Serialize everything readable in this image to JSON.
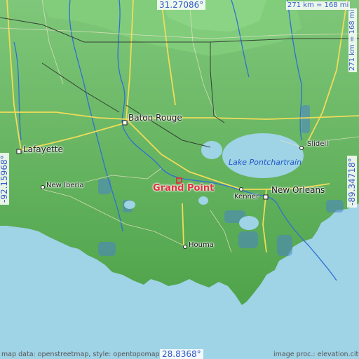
{
  "coords": {
    "top_lat": "31.27086°",
    "bottom_lat": "28.8368°",
    "left_lon": "-92.15968°",
    "right_lon": "-89.34718°"
  },
  "scale": {
    "horizontal": "271 km = 168 mi",
    "vertical": "271 km = 168 mi"
  },
  "target": {
    "name": "Grand Point",
    "color": "#e0303b"
  },
  "places": {
    "baton_rouge": "Baton Rouge",
    "lafayette": "Lafayette",
    "new_iberia": "New Iberia",
    "kenner": "Kenner",
    "new_orleans": "New Orleans",
    "houma": "Houma",
    "slidell": "Slidell"
  },
  "water_labels": {
    "lake_pontchartrain": "Lake Pontchartrain"
  },
  "credits": {
    "left": "map data: openstreetmap, style: opentopomap",
    "right": "image proc.: elevation.city"
  },
  "colors": {
    "land": "#4fa34a",
    "highland": "#6dbd67",
    "water": "#9fd3e6",
    "river": "#2f6fd4",
    "road": "#f0dc59",
    "border": "#2a2a2a"
  }
}
